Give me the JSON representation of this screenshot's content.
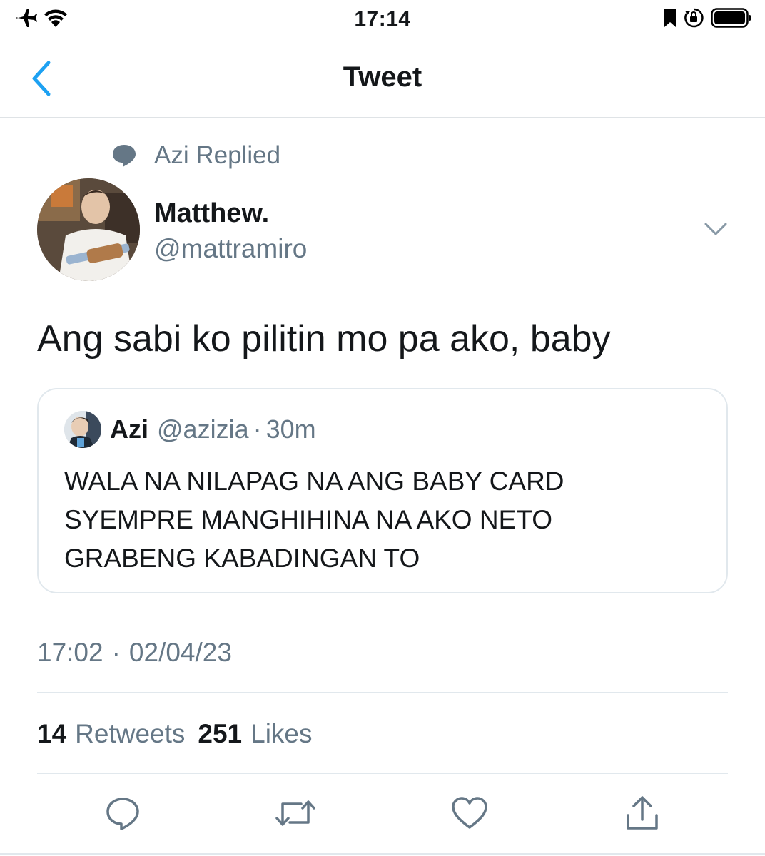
{
  "status_bar": {
    "time": "17:14",
    "icons": [
      "airplane-icon",
      "wifi-icon",
      "bookmark-icon",
      "orientation-lock-icon",
      "battery-icon"
    ]
  },
  "nav": {
    "title": "Tweet",
    "back_icon": "chevron-left-icon"
  },
  "replied": {
    "icon": "speech-bubble-icon",
    "text": "Azi Replied"
  },
  "author": {
    "name": "Matthew.",
    "handle": "@mattramiro"
  },
  "tweet": {
    "text": "Ang sabi ko pilitin mo pa ako, baby"
  },
  "quoted": {
    "name": "Azi",
    "handle": "@azizia",
    "separator": "·",
    "time": "30m",
    "lines": [
      "WALA NA NILAPAG NA ANG BABY CARD",
      "SYEMPRE MANGHIHINA NA AKO NETO",
      "GRABENG KABADINGAN TO"
    ]
  },
  "timestamp": {
    "time": "17:02",
    "separator": "·",
    "date": "02/04/23"
  },
  "stats": {
    "retweets_count": "14",
    "retweets_label": "Retweets",
    "likes_count": "251",
    "likes_label": "Likes"
  },
  "actions": [
    "reply-icon",
    "retweet-icon",
    "like-icon",
    "share-icon"
  ],
  "colors": {
    "accent": "#1da1f2",
    "muted_text": "#657786",
    "primary_text": "#14171a",
    "border": "#e1e8ed"
  }
}
